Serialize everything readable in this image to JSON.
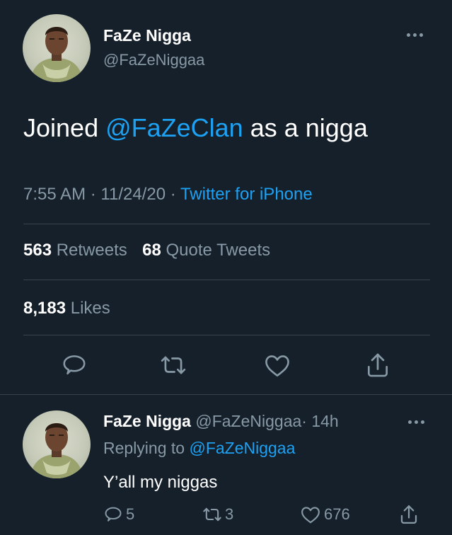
{
  "tweet": {
    "author_name": "FaZe Nigga",
    "author_handle": "@FaZeNiggaa",
    "text_before": "Joined ",
    "text_mention": "@FaZeClan",
    "text_after": " as a nigga",
    "time": "7:55 AM",
    "date": "11/24/20",
    "separator": "·",
    "source": "Twitter for iPhone",
    "retweets_count": "563",
    "retweets_label": "Retweets",
    "quotes_count": "68",
    "quotes_label": "Quote Tweets",
    "likes_count": "8,183",
    "likes_label": "Likes",
    "icons": [
      "reply-icon",
      "retweet-icon",
      "like-icon",
      "share-icon",
      "more-icon"
    ]
  },
  "reply": {
    "author_name": "FaZe Nigga",
    "author_handle": "@FaZeNiggaa",
    "separator": "·",
    "age": "14h",
    "replying_to_label": "Replying to",
    "replying_to_handle": "@FaZeNiggaa",
    "text": "Y’all my niggas",
    "reply_count": "5",
    "retweet_count": "3",
    "like_count": "676"
  },
  "colors": {
    "background": "#15202b",
    "text": "#ffffff",
    "muted": "#8899a6",
    "accent": "#1da1f2",
    "divider": "#38444d"
  }
}
